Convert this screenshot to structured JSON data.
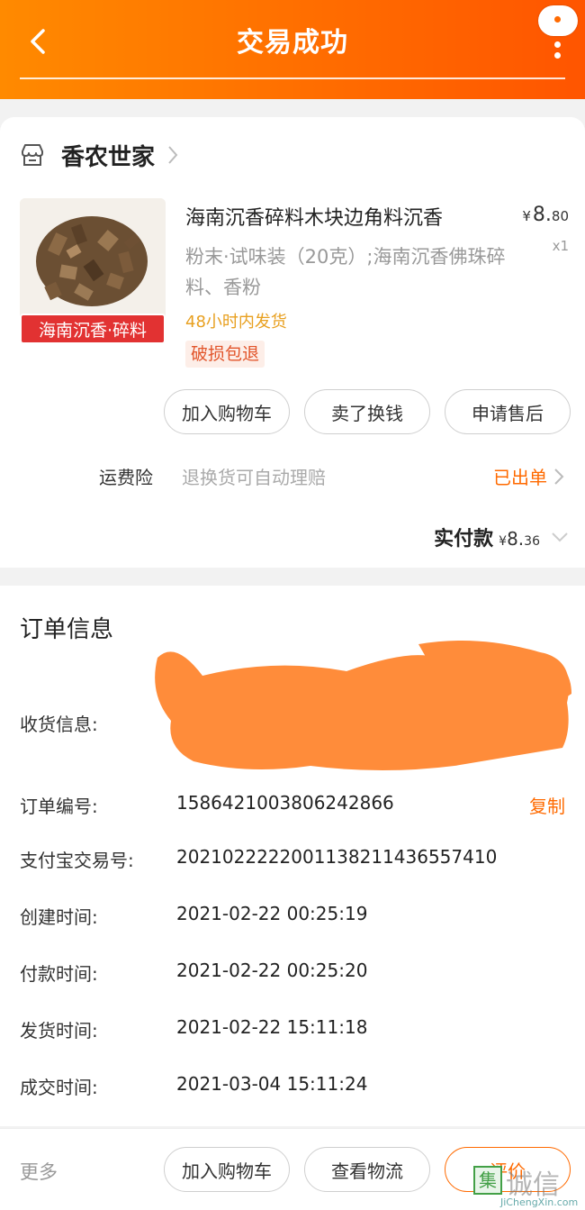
{
  "header": {
    "title": "交易成功",
    "bg_color": "#ff6a00"
  },
  "shop": {
    "name": "香农世家"
  },
  "product": {
    "title": "海南沉香碎料木块边角料沉香",
    "image_label": "海南沉香·碎料",
    "price_symbol": "¥",
    "price_int": "8.",
    "price_cents": "80",
    "quantity": "x1",
    "spec": "粉末·试味装（20克）;海南沉香佛珠碎料、香粉",
    "shipping_note": "48小时内发货",
    "refund_tag": "破损包退"
  },
  "actions": {
    "add_cart": "加入购物车",
    "resell": "卖了换钱",
    "after_sale": "申请售后"
  },
  "insurance": {
    "label": "运费险",
    "desc": "退换货可自动理赔",
    "status": "已出单"
  },
  "payment": {
    "label": "实付款",
    "symbol": "¥",
    "amount_int": "8.",
    "amount_cents": "36"
  },
  "order": {
    "heading": "订单信息",
    "receiver_label": "收货信息:",
    "order_no_label": "订单编号:",
    "order_no": "1586421003806242866",
    "copy": "复制",
    "alipay_label": "支付宝交易号:",
    "alipay_no": "2021022222001138211436557410",
    "created_label": "创建时间:",
    "created": "2021-02-22 00:25:19",
    "paid_label": "付款时间:",
    "paid": "2021-02-22 00:25:20",
    "shipped_label": "发货时间:",
    "shipped": "2021-02-22 15:11:18",
    "closed_label": "成交时间:",
    "closed": "2021-03-04 15:11:24"
  },
  "bottom": {
    "more": "更多",
    "add_cart": "加入购物车",
    "logistics": "查看物流",
    "review": "评价"
  },
  "watermark": {
    "logo_char": "集",
    "text": "诚信",
    "url": "JiChengXin.com"
  }
}
